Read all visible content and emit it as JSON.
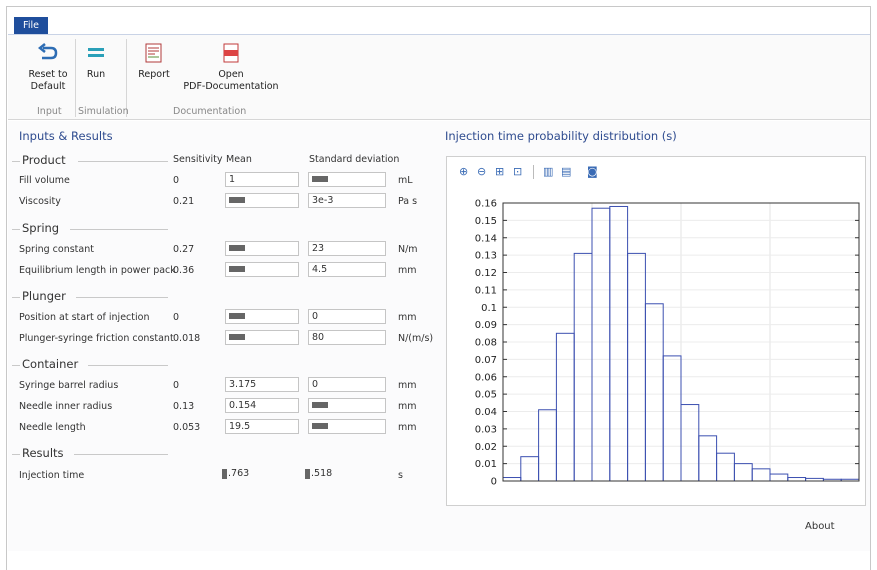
{
  "menu": {
    "file_label": "File"
  },
  "ribbon": {
    "buttons": {
      "reset": "Reset to\nDefault",
      "run": "Run",
      "report": "Report",
      "open_pdf": "Open\nPDF-Documentation"
    },
    "groups": {
      "input": "Input",
      "simulation": "Simulation",
      "documentation": "Documentation"
    }
  },
  "inputs": {
    "title": "Inputs & Results",
    "headers": {
      "sensitivity": "Sensitivity",
      "mean": "Mean",
      "std": "Standard deviation"
    },
    "groups": {
      "product": "Product",
      "spring": "Spring",
      "plunger": "Plunger",
      "container": "Container",
      "results": "Results"
    },
    "rows": [
      {
        "label": "Fill volume",
        "sensitivity": "0",
        "mean": "1",
        "mean_chip": false,
        "std": "",
        "std_chip": true,
        "unit": "mL"
      },
      {
        "label": "Viscosity",
        "sensitivity": "0.21",
        "mean": "",
        "mean_chip": true,
        "std": "3e-3",
        "std_chip": false,
        "unit": "Pa s"
      },
      {
        "label": "Spring constant",
        "sensitivity": "0.27",
        "mean": "",
        "mean_chip": true,
        "std": "23",
        "std_chip": false,
        "unit": "N/m"
      },
      {
        "label": "Equilibrium length in power pack",
        "sensitivity": "0.36",
        "mean": "",
        "mean_chip": true,
        "std": "4.5",
        "std_chip": false,
        "unit": "mm"
      },
      {
        "label": "Position at start of injection",
        "sensitivity": "0",
        "mean": "",
        "mean_chip": true,
        "std": "0",
        "std_chip": false,
        "unit": "mm"
      },
      {
        "label": "Plunger-syringe friction constant",
        "sensitivity": "0.018",
        "mean": "",
        "mean_chip": true,
        "std": "80",
        "std_chip": false,
        "unit": "N/(m/s)"
      },
      {
        "label": "Syringe barrel radius",
        "sensitivity": "0",
        "mean": "3.175",
        "mean_chip": false,
        "std": "0",
        "std_chip": false,
        "unit": "mm"
      },
      {
        "label": "Needle inner radius",
        "sensitivity": "0.13",
        "mean": "0.154",
        "mean_chip": false,
        "std": "",
        "std_chip": true,
        "unit": "mm"
      },
      {
        "label": "Needle length",
        "sensitivity": "0.053",
        "mean": "19.5",
        "mean_chip": false,
        "std": "",
        "std_chip": true,
        "unit": "mm"
      }
    ],
    "result": {
      "label": "Injection time",
      "mean": ".763",
      "std": ".518",
      "unit": "s"
    }
  },
  "chart_title": "Injection time probability distribution (s)",
  "chart_tools": [
    "zoom-in-icon",
    "zoom-out-icon",
    "zoom-box-icon",
    "zoom-extents-icon",
    "vertical-grid-icon",
    "horizontal-grid-icon",
    "camera-icon"
  ],
  "chart_data": {
    "type": "bar",
    "title": "",
    "xlabel": "",
    "ylabel": "",
    "ylim": [
      0,
      0.16
    ],
    "yticks": [
      "0",
      "0.01",
      "0.02",
      "0.03",
      "0.04",
      "0.05",
      "0.06",
      "0.07",
      "0.08",
      "0.09",
      "0.1",
      "0.11",
      "0.12",
      "0.13",
      "0.14",
      "0.15",
      "0.16"
    ],
    "values": [
      0.002,
      0.014,
      0.041,
      0.085,
      0.131,
      0.157,
      0.158,
      0.131,
      0.102,
      0.072,
      0.044,
      0.026,
      0.016,
      0.01,
      0.007,
      0.004,
      0.002,
      0.0015,
      0.001,
      0.001
    ],
    "bar_color": "#3b4fb0",
    "grid": true
  },
  "about_label": "About"
}
